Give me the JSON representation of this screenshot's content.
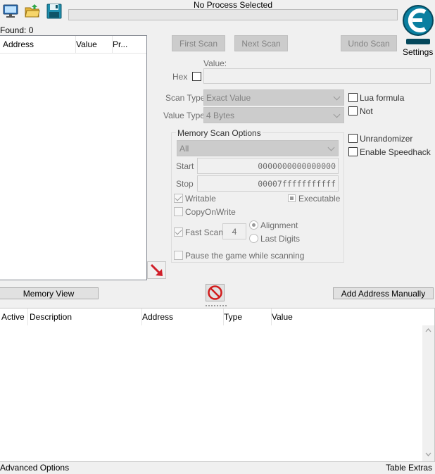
{
  "toolbar": {
    "open_process_icon": "computer-monitor-icon",
    "open_file_icon": "folder-open-icon",
    "save_icon": "floppy-disk-icon"
  },
  "process": {
    "title": "No Process Selected",
    "progress": 0
  },
  "logo": {
    "icon": "cheat-engine-logo-icon",
    "settings_label": "Settings"
  },
  "found": {
    "label": "Found: 0"
  },
  "results_list": {
    "columns": [
      "Address",
      "Value",
      "Pr..."
    ]
  },
  "scan_buttons": {
    "first_scan": "First Scan",
    "next_scan": "Next Scan",
    "undo_scan": "Undo Scan"
  },
  "value_section": {
    "value_label": "Value:",
    "hex_label": "Hex",
    "value_input": ""
  },
  "scan_type": {
    "label": "Scan Type",
    "selected": "Exact Value"
  },
  "value_type": {
    "label": "Value Type",
    "selected": "4 Bytes"
  },
  "right_options": {
    "lua_formula": "Lua formula",
    "not": "Not",
    "unrandomizer": "Unrandomizer",
    "enable_speedhack": "Enable Speedhack"
  },
  "memory_scan_options": {
    "title": "Memory Scan Options",
    "region": "All",
    "start_label": "Start",
    "start_value": "0000000000000000",
    "stop_label": "Stop",
    "stop_value": "00007fffffffffff",
    "writable": "Writable",
    "executable": "Executable",
    "copy_on_write": "CopyOnWrite",
    "fast_scan": "Fast Scan",
    "fast_scan_value": "4",
    "alignment": "Alignment",
    "last_digits": "Last Digits",
    "pause_game": "Pause the game while scanning"
  },
  "actions": {
    "memory_view": "Memory View",
    "add_address_manually": "Add Address Manually"
  },
  "address_table": {
    "columns": [
      "Active",
      "Description",
      "Address",
      "Type",
      "Value"
    ]
  },
  "bottom": {
    "advanced_options": "Advanced Options",
    "table_extras": "Table Extras"
  },
  "colors": {
    "accent_teal": "#0a7fa0",
    "arrow_red": "#d0202a",
    "stop_red": "#d21c1c"
  }
}
